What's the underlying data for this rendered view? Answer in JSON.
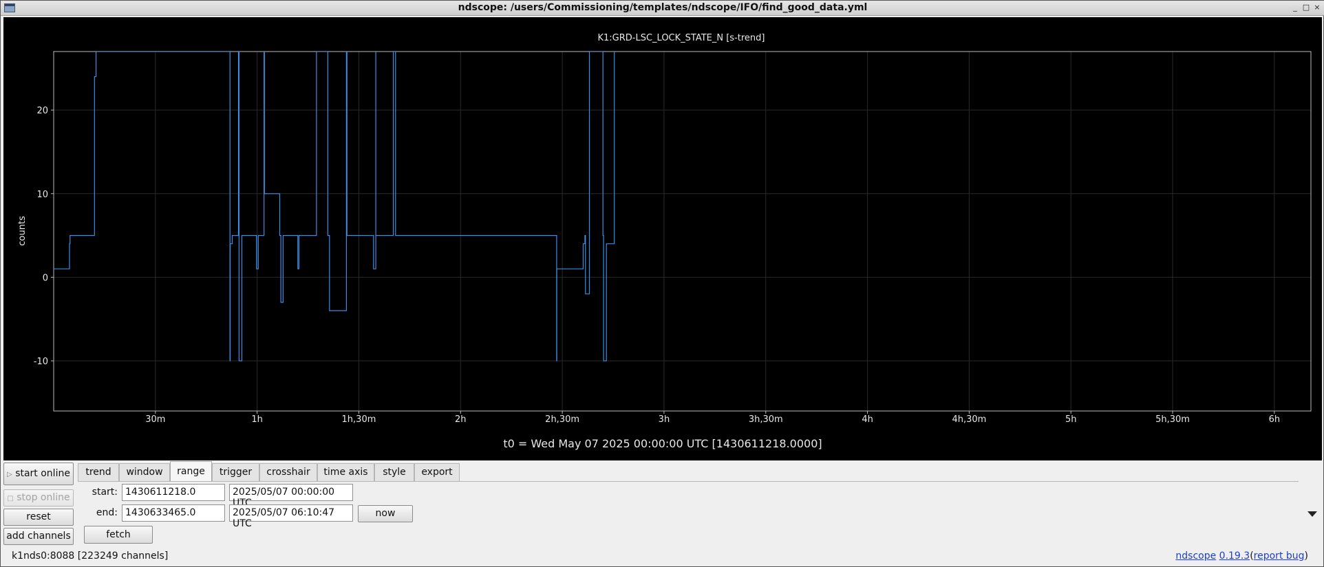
{
  "window": {
    "title": "ndscope: /users/Commissioning/templates/ndscope/IFO/find_good_data.yml",
    "controls": [
      "_",
      "□",
      "×"
    ]
  },
  "plot": {
    "channel_title": "K1:GRD-LSC_LOCK_STATE_N [s-trend]",
    "t0_label": "t0 = Wed May 07 2025 00:00:00 UTC [1430611218.0000]",
    "line_color": "#3a8ee6",
    "background": "#000000"
  },
  "chart_data": {
    "type": "line",
    "title": "K1:GRD-LSC_LOCK_STATE_N [s-trend]",
    "ylabel": "counts",
    "xlabel": "t0 = Wed May 07 2025 00:00:00 UTC [1430611218.0000]",
    "x_unit": "seconds from t0",
    "xlim": [
      0,
      22247
    ],
    "ylim": [
      -16,
      27
    ],
    "grid": true,
    "y_ticks": [
      -10,
      0,
      10,
      20
    ],
    "x_ticks": [
      {
        "label": "30m",
        "value": 1800
      },
      {
        "label": "1h",
        "value": 3600
      },
      {
        "label": "1h,30m",
        "value": 5400
      },
      {
        "label": "2h",
        "value": 7200
      },
      {
        "label": "2h,30m",
        "value": 9000
      },
      {
        "label": "3h",
        "value": 10800
      },
      {
        "label": "3h,30m",
        "value": 12600
      },
      {
        "label": "4h",
        "value": 14400
      },
      {
        "label": "4h,30m",
        "value": 16200
      },
      {
        "label": "5h",
        "value": 18000
      },
      {
        "label": "5h,30m",
        "value": 19800
      },
      {
        "label": "6h",
        "value": 21600
      }
    ],
    "series": [
      {
        "x": [
          0,
          270,
          280,
          290,
          300,
          720,
          722,
          750,
          1860,
          3120,
          3123,
          3160,
          3180,
          3270,
          3280,
          3330,
          3580,
          3590,
          3620,
          3720,
          3722,
          3730,
          4000,
          4020,
          4060,
          4270,
          4320,
          4340,
          4400,
          4650,
          4850,
          4880,
          5180,
          5190,
          5240,
          5650,
          5660,
          5700,
          5700,
          5750,
          6000,
          6010,
          6050,
          6520,
          8900,
          8902,
          9360,
          9370,
          9400,
          9410,
          9480,
          9600,
          9720,
          9730,
          9780,
          9920
        ],
        "y": [
          1,
          1,
          4,
          5,
          5,
          5,
          24,
          27,
          27,
          -10,
          4,
          5,
          5,
          27,
          -10,
          5,
          5,
          1,
          5,
          5,
          27,
          10,
          5,
          -3,
          5,
          5,
          1,
          5,
          5,
          27,
          5,
          -4,
          27,
          5,
          5,
          5,
          1,
          27,
          5,
          5,
          5,
          27,
          5,
          5,
          -10,
          1,
          1,
          4,
          5,
          -2,
          27,
          27,
          5,
          -10,
          4,
          27
        ]
      }
    ]
  },
  "controls": {
    "start_online": "start online",
    "stop_online": "stop online",
    "reset": "reset",
    "add_channels": "add channels",
    "tabs": [
      "trend",
      "window",
      "range",
      "trigger",
      "crosshair",
      "time axis",
      "style",
      "export"
    ],
    "active_tab": "range",
    "range": {
      "start_label": "start:",
      "end_label": "end:",
      "start_gps": "1430611218.0",
      "start_utc": "2025/05/07 00:00:00 UTC",
      "end_gps": "1430633465.0",
      "end_utc": "2025/05/07 06:10:47 UTC",
      "now_button": "now",
      "fetch_button": "fetch"
    }
  },
  "status": {
    "server": "k1nds0:8088",
    "channels": "[223249 channels]"
  },
  "version": {
    "app": "ndscope",
    "number": "0.19.3",
    "open_paren": "(",
    "report": "report bug",
    "close_paren": ")"
  }
}
